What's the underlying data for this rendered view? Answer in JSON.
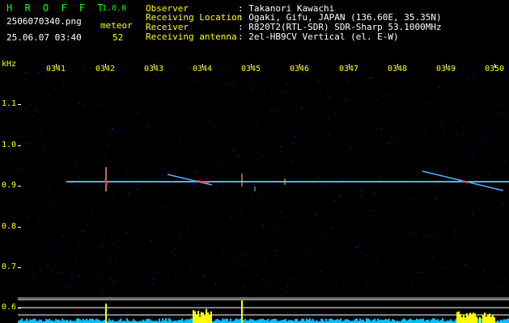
{
  "app": {
    "name": "H R O F F T",
    "version": "1.0.0",
    "filename": "2506070340.png",
    "timestamp": "25.06.07 03:40",
    "event_label": "meteor",
    "event_count": "52"
  },
  "info": {
    "observer_label": "Observer",
    "observer_value": ": Takanori Kawachi",
    "location_label": "Receiving Location",
    "location_value": ": Ogaki, Gifu, JAPAN (136.60E, 35.35N)",
    "receiver_label": "Receiver",
    "receiver_value": ": R820T2(RTL-SDR) SDR-Sharp 53.1000MHz",
    "antenna_label": "Receiving antenna",
    "antenna_value": ": 2el-HB9CV Vertical (el. E-W)"
  },
  "axis": {
    "unit": "kHz",
    "time_ticks": [
      "0341",
      "0342",
      "0343",
      "0344",
      "0345",
      "0346",
      "0347",
      "0348",
      "0349",
      "0350"
    ],
    "freq_ticks": [
      "1.1",
      "1.0",
      "0.9",
      "0.8",
      "0.7",
      "0.6"
    ]
  },
  "colors": {
    "background": "#000000",
    "text_white": "#ffffff",
    "text_yellow": "#ffff00",
    "text_green": "#00ff00",
    "noise_blue": "#101060",
    "carrier": "#40c0ff",
    "histogram": "#ffff00",
    "histogram_base": "#00c0ff"
  }
}
